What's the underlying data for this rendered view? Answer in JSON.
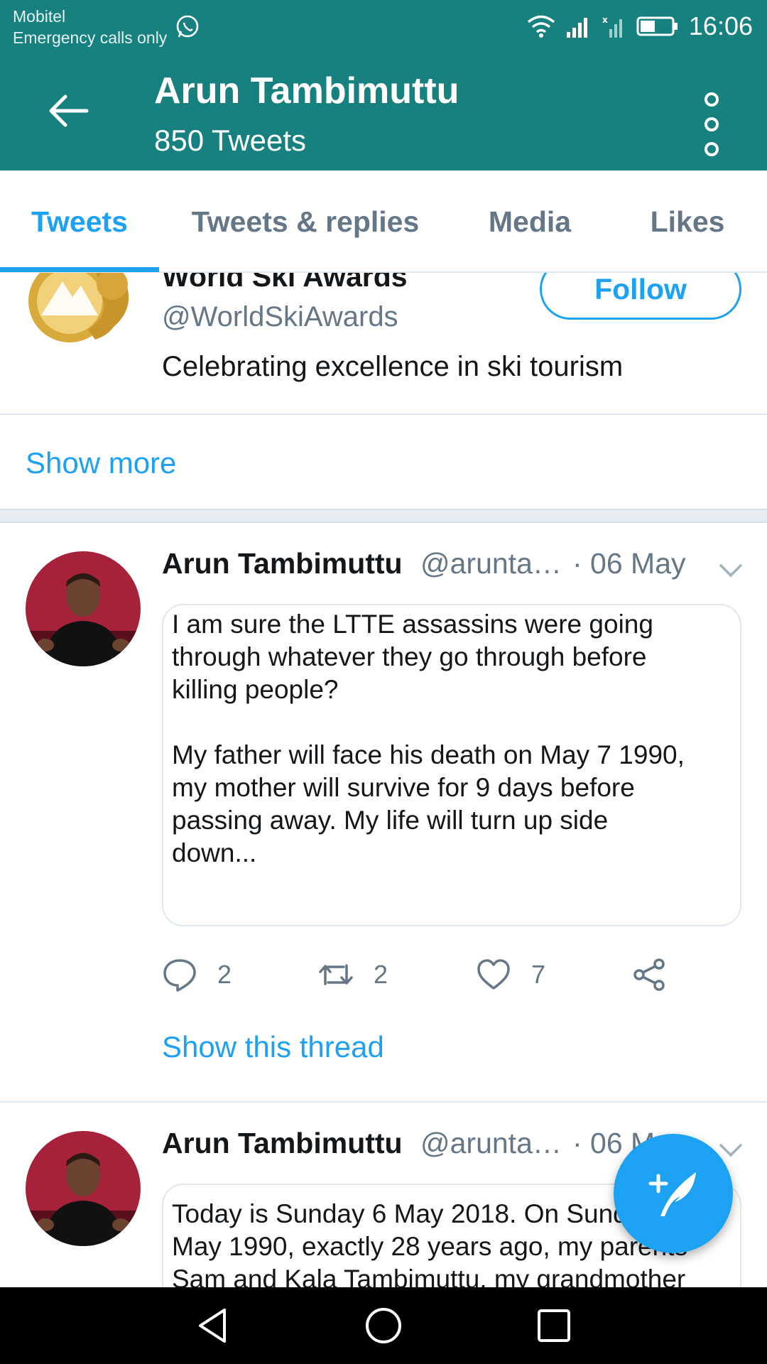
{
  "status_bar": {
    "carrier": "Mobitel",
    "carrier_note": "Emergency calls only",
    "time": "16:06"
  },
  "header": {
    "title": "Arun Tambimuttu",
    "subtitle": "850 Tweets"
  },
  "tabs": [
    {
      "label": "Tweets",
      "active": true
    },
    {
      "label": "Tweets & replies",
      "active": false
    },
    {
      "label": "Media",
      "active": false
    },
    {
      "label": "Likes",
      "active": false
    }
  ],
  "suggested_account": {
    "name": "World Ski Awards",
    "handle": "@WorldSkiAwards",
    "bio": "Celebrating excellence in ski tourism",
    "follow_label": "Follow"
  },
  "show_more_label": "Show more",
  "tweets": [
    {
      "name": "Arun Tambimuttu",
      "handle": "@arunta…",
      "date": "· 06 May",
      "lines": [
        "I am sure the LTTE assassins were going",
        "through whatever they go through before",
        "killing people?",
        "",
        "My father will face his death on May 7 1990,",
        "my mother will survive for 9 days before",
        "passing away. My life will turn up side",
        "down..."
      ],
      "replies": "2",
      "retweets": "2",
      "likes": "7",
      "thread_label": "Show this thread"
    },
    {
      "name": "Arun Tambimuttu",
      "handle": "@arunta…",
      "date": "· 06 May",
      "lines": [
        "Today is Sunday 6 May 2018. On Sunday 6",
        "May 1990, exactly 28 years ago, my parents",
        "Sam and Kala Tambimuttu, my grandmother"
      ]
    }
  ],
  "colors": {
    "header_bg": "#16817f",
    "accent": "#1da1f2",
    "secondary_text": "#657786"
  },
  "icons": [
    "whatsapp-icon",
    "wifi-icon",
    "signal-icon",
    "battery-icon",
    "back-arrow-icon",
    "more-vertical-icon",
    "reply-icon",
    "retweet-icon",
    "like-icon",
    "share-icon",
    "compose-tweet-icon",
    "chevron-down-icon",
    "nav-back-icon",
    "nav-home-icon",
    "nav-recents-icon"
  ]
}
